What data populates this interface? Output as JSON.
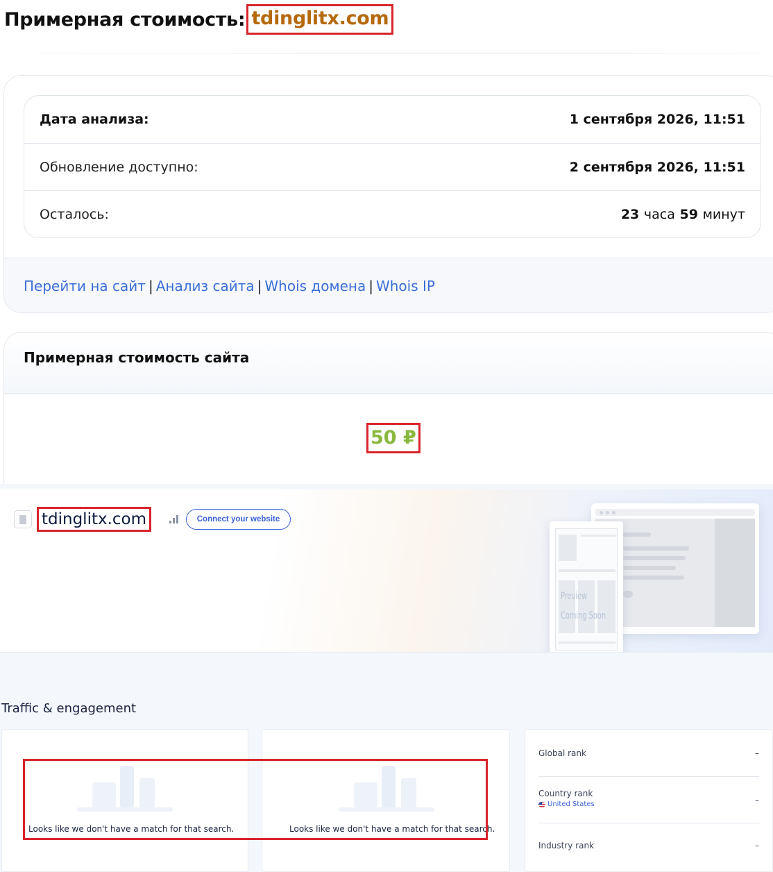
{
  "header": {
    "title_prefix": "Примерная стоимость:",
    "domain": "tdinglitx.com"
  },
  "analysis": {
    "rows": [
      {
        "label": "Дата анализа:",
        "value": "1 сентября 2026, 11:51"
      },
      {
        "label": "Обновление доступно:",
        "value": "2 сентября 2026, 11:51"
      },
      {
        "label": "Осталось:",
        "hours": "23",
        "hours_unit": "часа",
        "minutes": "59",
        "minutes_unit": "минут"
      }
    ],
    "links": [
      "Перейти на сайт",
      "Анализ сайта",
      "Whois домена",
      "Whois IP"
    ],
    "separator": "|"
  },
  "valuation": {
    "heading": "Примерная стоимость сайта",
    "price": "50 ₽"
  },
  "site_overview": {
    "domain": "tdinglitx.com",
    "connect_label": "Connect your website",
    "preview_line1": "Preview",
    "preview_line2": "Coming Soon"
  },
  "traffic": {
    "title": "Traffic & engagement",
    "empty_message": "Looks like we don't have a match for that search.",
    "ranks": [
      {
        "label": "Global rank",
        "value": "–"
      },
      {
        "label": "Country rank",
        "sub": "United States",
        "value": "–"
      },
      {
        "label": "Industry rank",
        "value": "–"
      }
    ]
  },
  "colors": {
    "domain_highlight": "#b5690b",
    "price": "#8ab83d",
    "link": "#3b6fd8",
    "annotation_red": "#d9242b",
    "accent_blue": "#3a62d7"
  },
  "icons": [
    "file-icon",
    "bars-icon",
    "us-flag-icon"
  ]
}
